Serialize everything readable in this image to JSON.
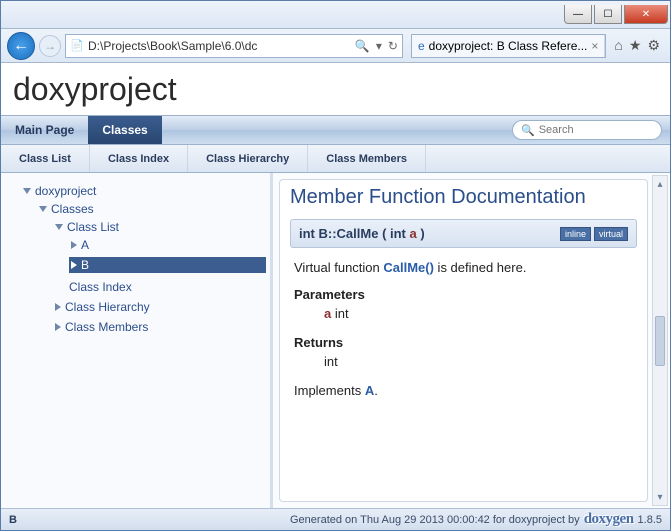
{
  "browser": {
    "address": "D:\\Projects\\Book\\Sample\\6.0\\dc",
    "tab_title": "doxyproject: B Class Refere..."
  },
  "project": {
    "title": "doxyproject"
  },
  "mainmenu": {
    "main_page": "Main Page",
    "classes": "Classes"
  },
  "search": {
    "placeholder": "Search"
  },
  "submenu": {
    "class_list": "Class List",
    "class_index": "Class Index",
    "class_hierarchy": "Class Hierarchy",
    "class_members": "Class Members"
  },
  "tree": {
    "root": "doxyproject",
    "classes": "Classes",
    "class_list": "Class List",
    "a": "A",
    "b": "B",
    "class_index": "Class Index",
    "class_hierarchy": "Class Hierarchy",
    "class_members": "Class Members"
  },
  "doc": {
    "heading": "Member Function Documentation",
    "sig_ret": "int B::CallMe",
    "sig_open": " ( int  ",
    "sig_param": "a",
    "sig_close": " )",
    "badge_inline": "inline",
    "badge_virtual": "virtual",
    "desc_pre": "Virtual function ",
    "desc_link": "CallMe()",
    "desc_post": " is defined here.",
    "params_h": "Parameters",
    "param_name": "a",
    "param_type": " int",
    "returns_h": "Returns",
    "returns_v": "int",
    "impl_pre": "Implements ",
    "impl_link": "A",
    "impl_post": "."
  },
  "footer": {
    "crumb": "B",
    "gen": "Generated on Thu Aug 29 2013 00:00:42 for doxyproject by",
    "logo": "doxygen",
    "ver": "1.8.5"
  }
}
